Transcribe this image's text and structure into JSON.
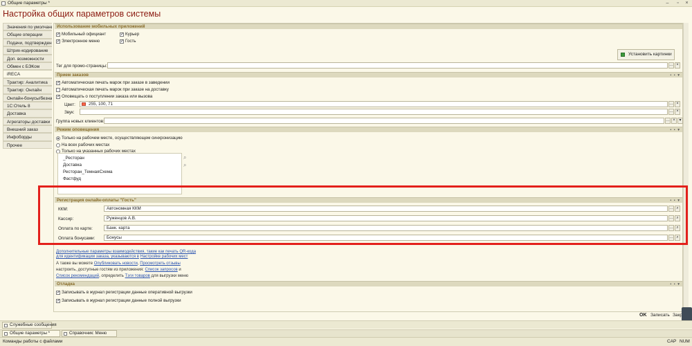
{
  "window": {
    "title": "Общие параметры *"
  },
  "heading": "Настройка общих параметров системы",
  "sidebar": {
    "items": [
      "Значения по умолчанию",
      "Общие операции",
      "Подачи, подтверждения",
      "Штрих-кодирование",
      "Доп. возможности",
      "Обмен с БЭКом",
      "iRECA",
      "Трактир: Аналитика",
      "Трактир: Онлайн",
      "Онлайн-бонусы/безнал",
      "1С:Отель 8",
      "Доставка",
      "Агрегаторы доставки",
      "Внешний заказ",
      "Инфоборды",
      "Прочее"
    ]
  },
  "mobile": {
    "header": "Использование мобильных приложений",
    "mobile_waiter": "Мобильный официант",
    "courier": "Курьер",
    "emenu": "Электронное меню",
    "guest": "Гость",
    "install_images": "Установить картинки",
    "promo_tag_label": "Тег для промо-страницы:",
    "promo_tag_value": ""
  },
  "orders": {
    "header": "Прием заказов",
    "auto_print_venue": "Автоматическая печать марок при заказе в заведении",
    "auto_print_delivery": "Автоматическая печать марок при заказе на доставку",
    "notify": "Оповещать о поступлении заказа или вызова",
    "color_label": "Цвет:",
    "color_value": "255, 100, 71",
    "sound_label": "Звук:",
    "sound_value": "",
    "new_clients_label": "Группа новых клиентов:",
    "new_clients_value": ""
  },
  "notify_mode": {
    "header": "Режим оповещения",
    "opt1": "Только на рабочем месте, осуществляющем синхронизацию",
    "opt2": "На всех рабочих местах",
    "opt3": "Только на указанных рабочих местах",
    "workplaces": [
      "_Ресторан",
      "Доставка",
      "Ресторан_ТемнаяСхема",
      "Фастфуд"
    ]
  },
  "payment": {
    "header": "Регистрация онлайн-оплаты \"Гость\"",
    "kkm_label": "ККМ:",
    "kkm_value": "Автономная ККМ",
    "cashier_label": "Кассир:",
    "cashier_value": "Руженцов А.В.",
    "card_label": "Оплата по карте:",
    "card_value": "Банк. карта",
    "bonus_label": "Оплата бонусами:",
    "bonus_value": "Бонусы"
  },
  "info": {
    "line1": "Дополнительные параметры взаимодействия, такие как печать QR-кода",
    "line2a": "для идентификации заказа, указываются в",
    "line2_link": "Настройке рабочих мест",
    "line3a": "А также вы можете",
    "line3_link1": "Опубликовать новости",
    "line3_sep": ",",
    "line3_link2": "Просмотреть отзывы",
    "line4a": "настроить, доступные гостям из приложения:",
    "line4_link": "Список запросов",
    "line4b": "и",
    "line5_link1": "Список рекомендаций",
    "line5a": ", определить",
    "line5_link2": "Тэги товаров",
    "line5b": "для выгрузки меню"
  },
  "debug": {
    "header": "Отладка",
    "log_online": "Записывать в журнал регистрации данные оперативной выгрузки",
    "log_full": "Записывать в журнал регистрации данные полной выгрузки"
  },
  "footer": {
    "ok": "OK",
    "save": "Записать",
    "close": "Закр"
  },
  "tabs": {
    "service_messages": "Служебные сообщения"
  },
  "taskbar": {
    "item1": "Общие параметры *",
    "item2": "Справочник: Меню"
  },
  "status": {
    "text": "Команды работы с файлами",
    "cap": "CAP",
    "num": "NUM"
  },
  "colors": {
    "accent_heading": "#8b1a10",
    "highlight": "#e3201b",
    "swatch": "#ff6447"
  }
}
